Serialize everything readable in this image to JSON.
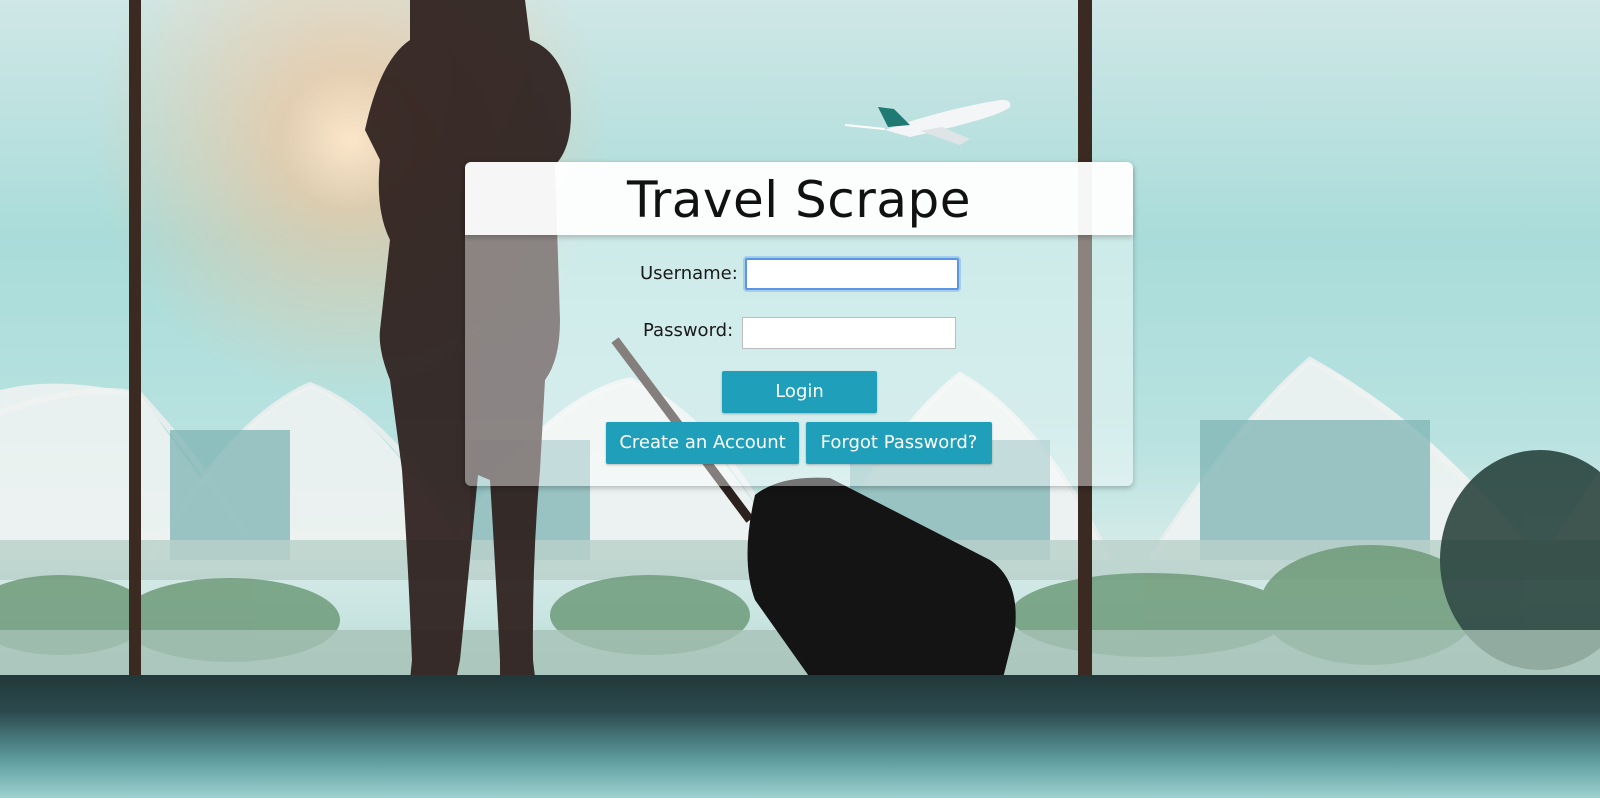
{
  "app": {
    "title": "Travel Scrape"
  },
  "login_form": {
    "username_label": "Username:",
    "username_value": "",
    "password_label": "Password:",
    "password_value": "",
    "login_button": "Login",
    "create_account_button": "Create an Account",
    "forgot_password_button": "Forgot Password?"
  },
  "colors": {
    "button_bg": "#1f9fb9",
    "button_text": "#ffffff",
    "focus_ring": "#5a95e8"
  }
}
